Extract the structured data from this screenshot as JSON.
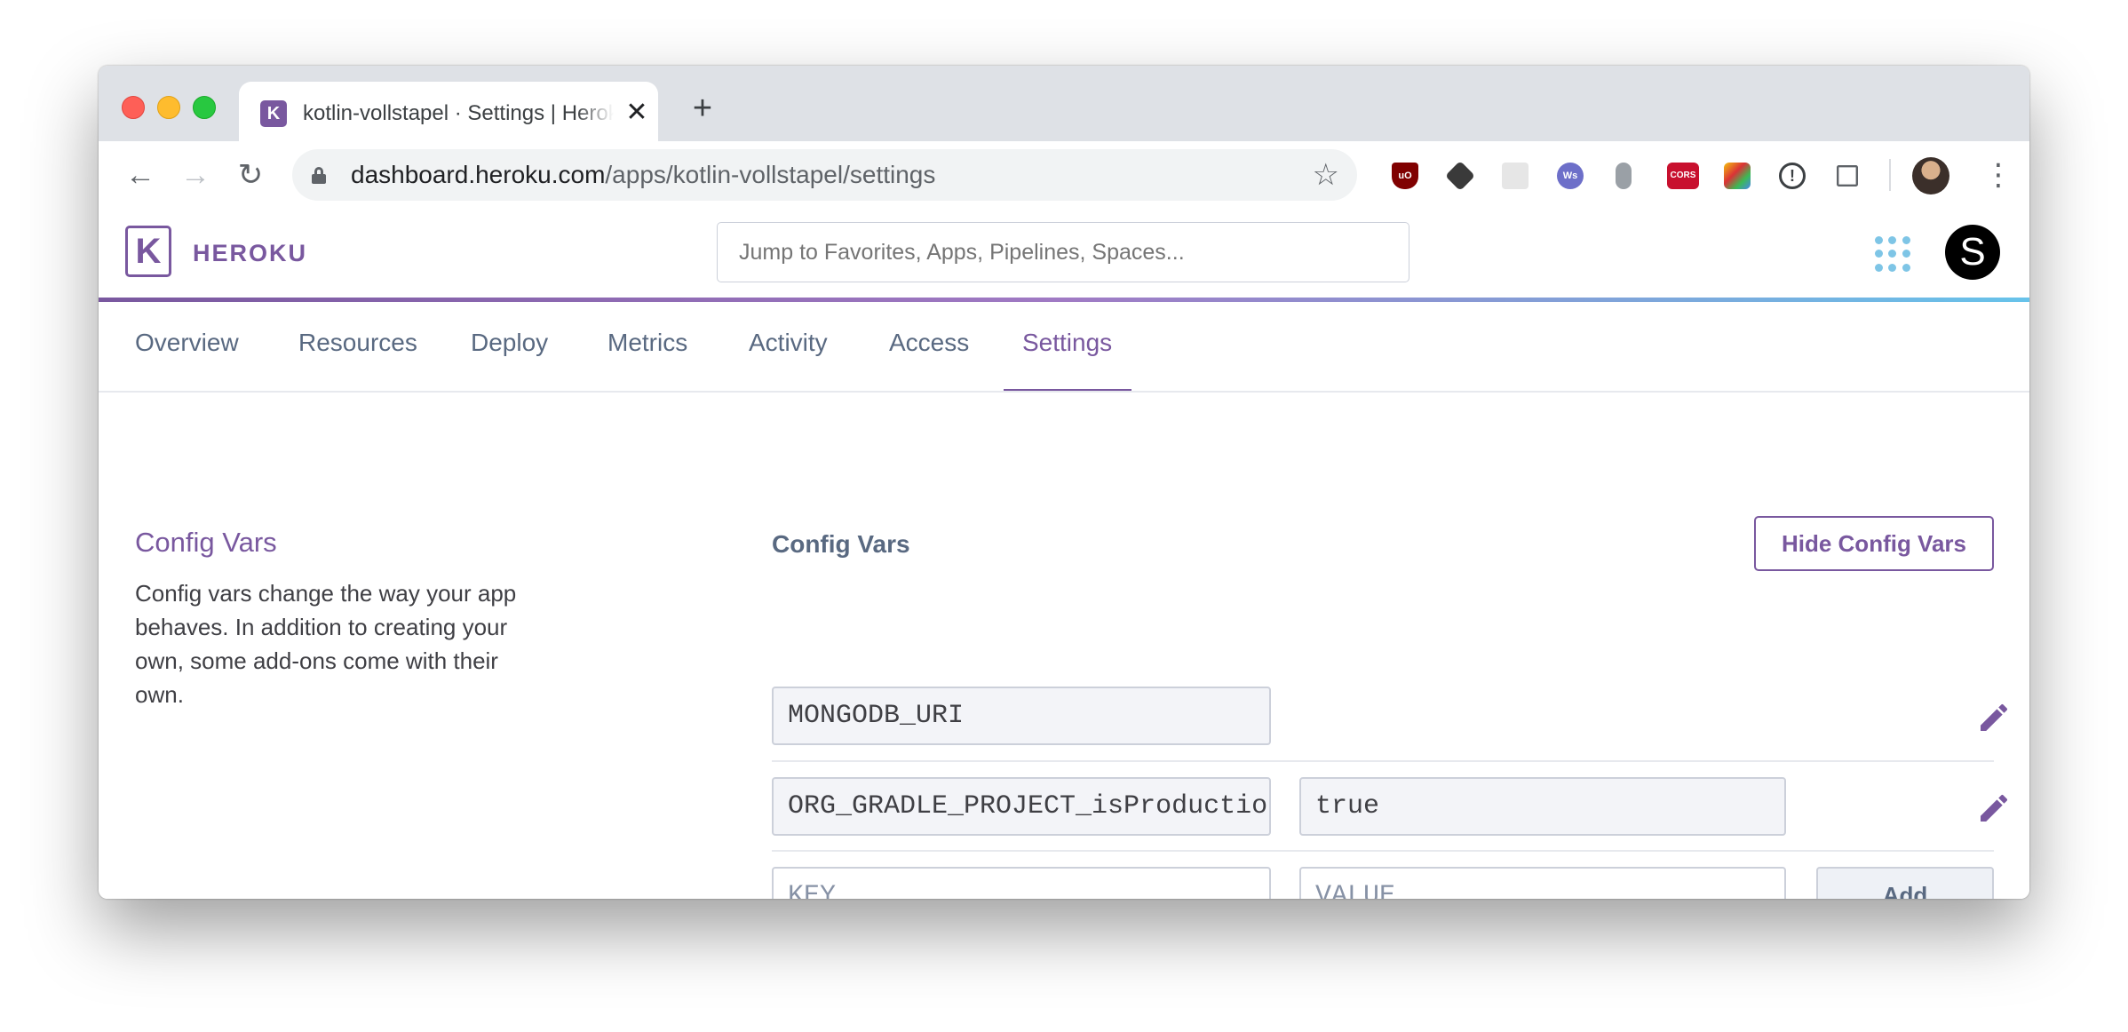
{
  "browser": {
    "tab": {
      "title": "kotlin-vollstapel · Settings | Heroku",
      "favicon": "heroku-favicon",
      "close_glyph": "✕"
    },
    "new_tab_glyph": "+",
    "nav": {
      "back_glyph": "←",
      "forward_glyph": "→",
      "reload_glyph": "↻"
    },
    "url": {
      "host": "dashboard.heroku.com",
      "path": "/apps/kotlin-vollstapel/settings"
    },
    "star_glyph": "☆",
    "extensions": [
      "ublock-icon",
      "cube-icon",
      "react-icon",
      "ws-icon",
      "mouse-icon",
      "cors-icon",
      "screenshot-icon",
      "info-icon",
      "grid-icon"
    ],
    "ext_labels": {
      "ublock": "uO",
      "ws": "Ws",
      "cors": "CORS",
      "info": "!"
    },
    "menu_glyph": "⋮"
  },
  "heroku": {
    "logo_glyph": "K",
    "wordmark": "HEROKU",
    "search_placeholder": "Jump to Favorites, Apps, Pipelines, Spaces...",
    "account_initial": "S",
    "accent_color": "#79589f"
  },
  "subnav": {
    "items": [
      "Overview",
      "Resources",
      "Deploy",
      "Metrics",
      "Activity",
      "Access",
      "Settings"
    ],
    "active": "Settings"
  },
  "config_section": {
    "heading": "Config Vars",
    "description": "Config vars change the way your app behaves. In addition to creating your own, some add-ons come with their own."
  },
  "config_vars": {
    "title": "Config Vars",
    "hide_button": "Hide Config Vars",
    "rows": [
      {
        "key": "MONGODB_URI",
        "value": ""
      },
      {
        "key": "ORG_GRADLE_PROJECT_isProduction",
        "value": "true"
      }
    ],
    "new_key_placeholder": "KEY",
    "new_value_placeholder": "VALUE",
    "add_button": "Add"
  }
}
